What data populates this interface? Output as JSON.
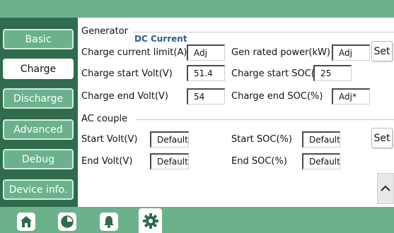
{
  "sidebar": {
    "items": [
      {
        "label": "Basic"
      },
      {
        "label": "Charge"
      },
      {
        "label": "Discharge"
      },
      {
        "label": "Advanced"
      },
      {
        "label": "Debug"
      },
      {
        "label": "Device info."
      }
    ],
    "active": "Charge"
  },
  "generator": {
    "title": "Generator",
    "subtitle": "DC Current",
    "charge_current_limit": {
      "label": "Charge current limit(A)",
      "value": "Adj"
    },
    "gen_rated_power": {
      "label": "Gen rated power(kW)",
      "value": "Adj"
    },
    "charge_start_volt": {
      "label": "Charge start Volt(V)",
      "value": "51.4"
    },
    "charge_start_soc": {
      "label": "Charge start SOC(%)",
      "value": "25"
    },
    "charge_end_volt": {
      "label": "Charge end Volt(V)",
      "value": "54"
    },
    "charge_end_soc": {
      "label": "Charge end SOC(%)",
      "value": "Adj*"
    },
    "set_label": "Set"
  },
  "ac_couple": {
    "title": "AC couple",
    "start_volt": {
      "label": "Start Volt(V)",
      "value": "Default"
    },
    "start_soc": {
      "label": "Start SOC(%)",
      "value": "Default"
    },
    "end_volt": {
      "label": "End Volt(V)",
      "value": "Default"
    },
    "end_soc": {
      "label": "End SOC(%)",
      "value": "Default"
    },
    "set_label": "Set"
  },
  "bottom_nav": {
    "items": [
      {
        "icon": "home-icon"
      },
      {
        "icon": "pie-chart-icon"
      },
      {
        "icon": "bell-icon"
      },
      {
        "icon": "gear-icon"
      }
    ],
    "active": "gear-icon"
  },
  "colors": {
    "bar": "#6bb28c",
    "sidebar": "#2f6b4c",
    "accent_text": "#2f5e8a"
  }
}
